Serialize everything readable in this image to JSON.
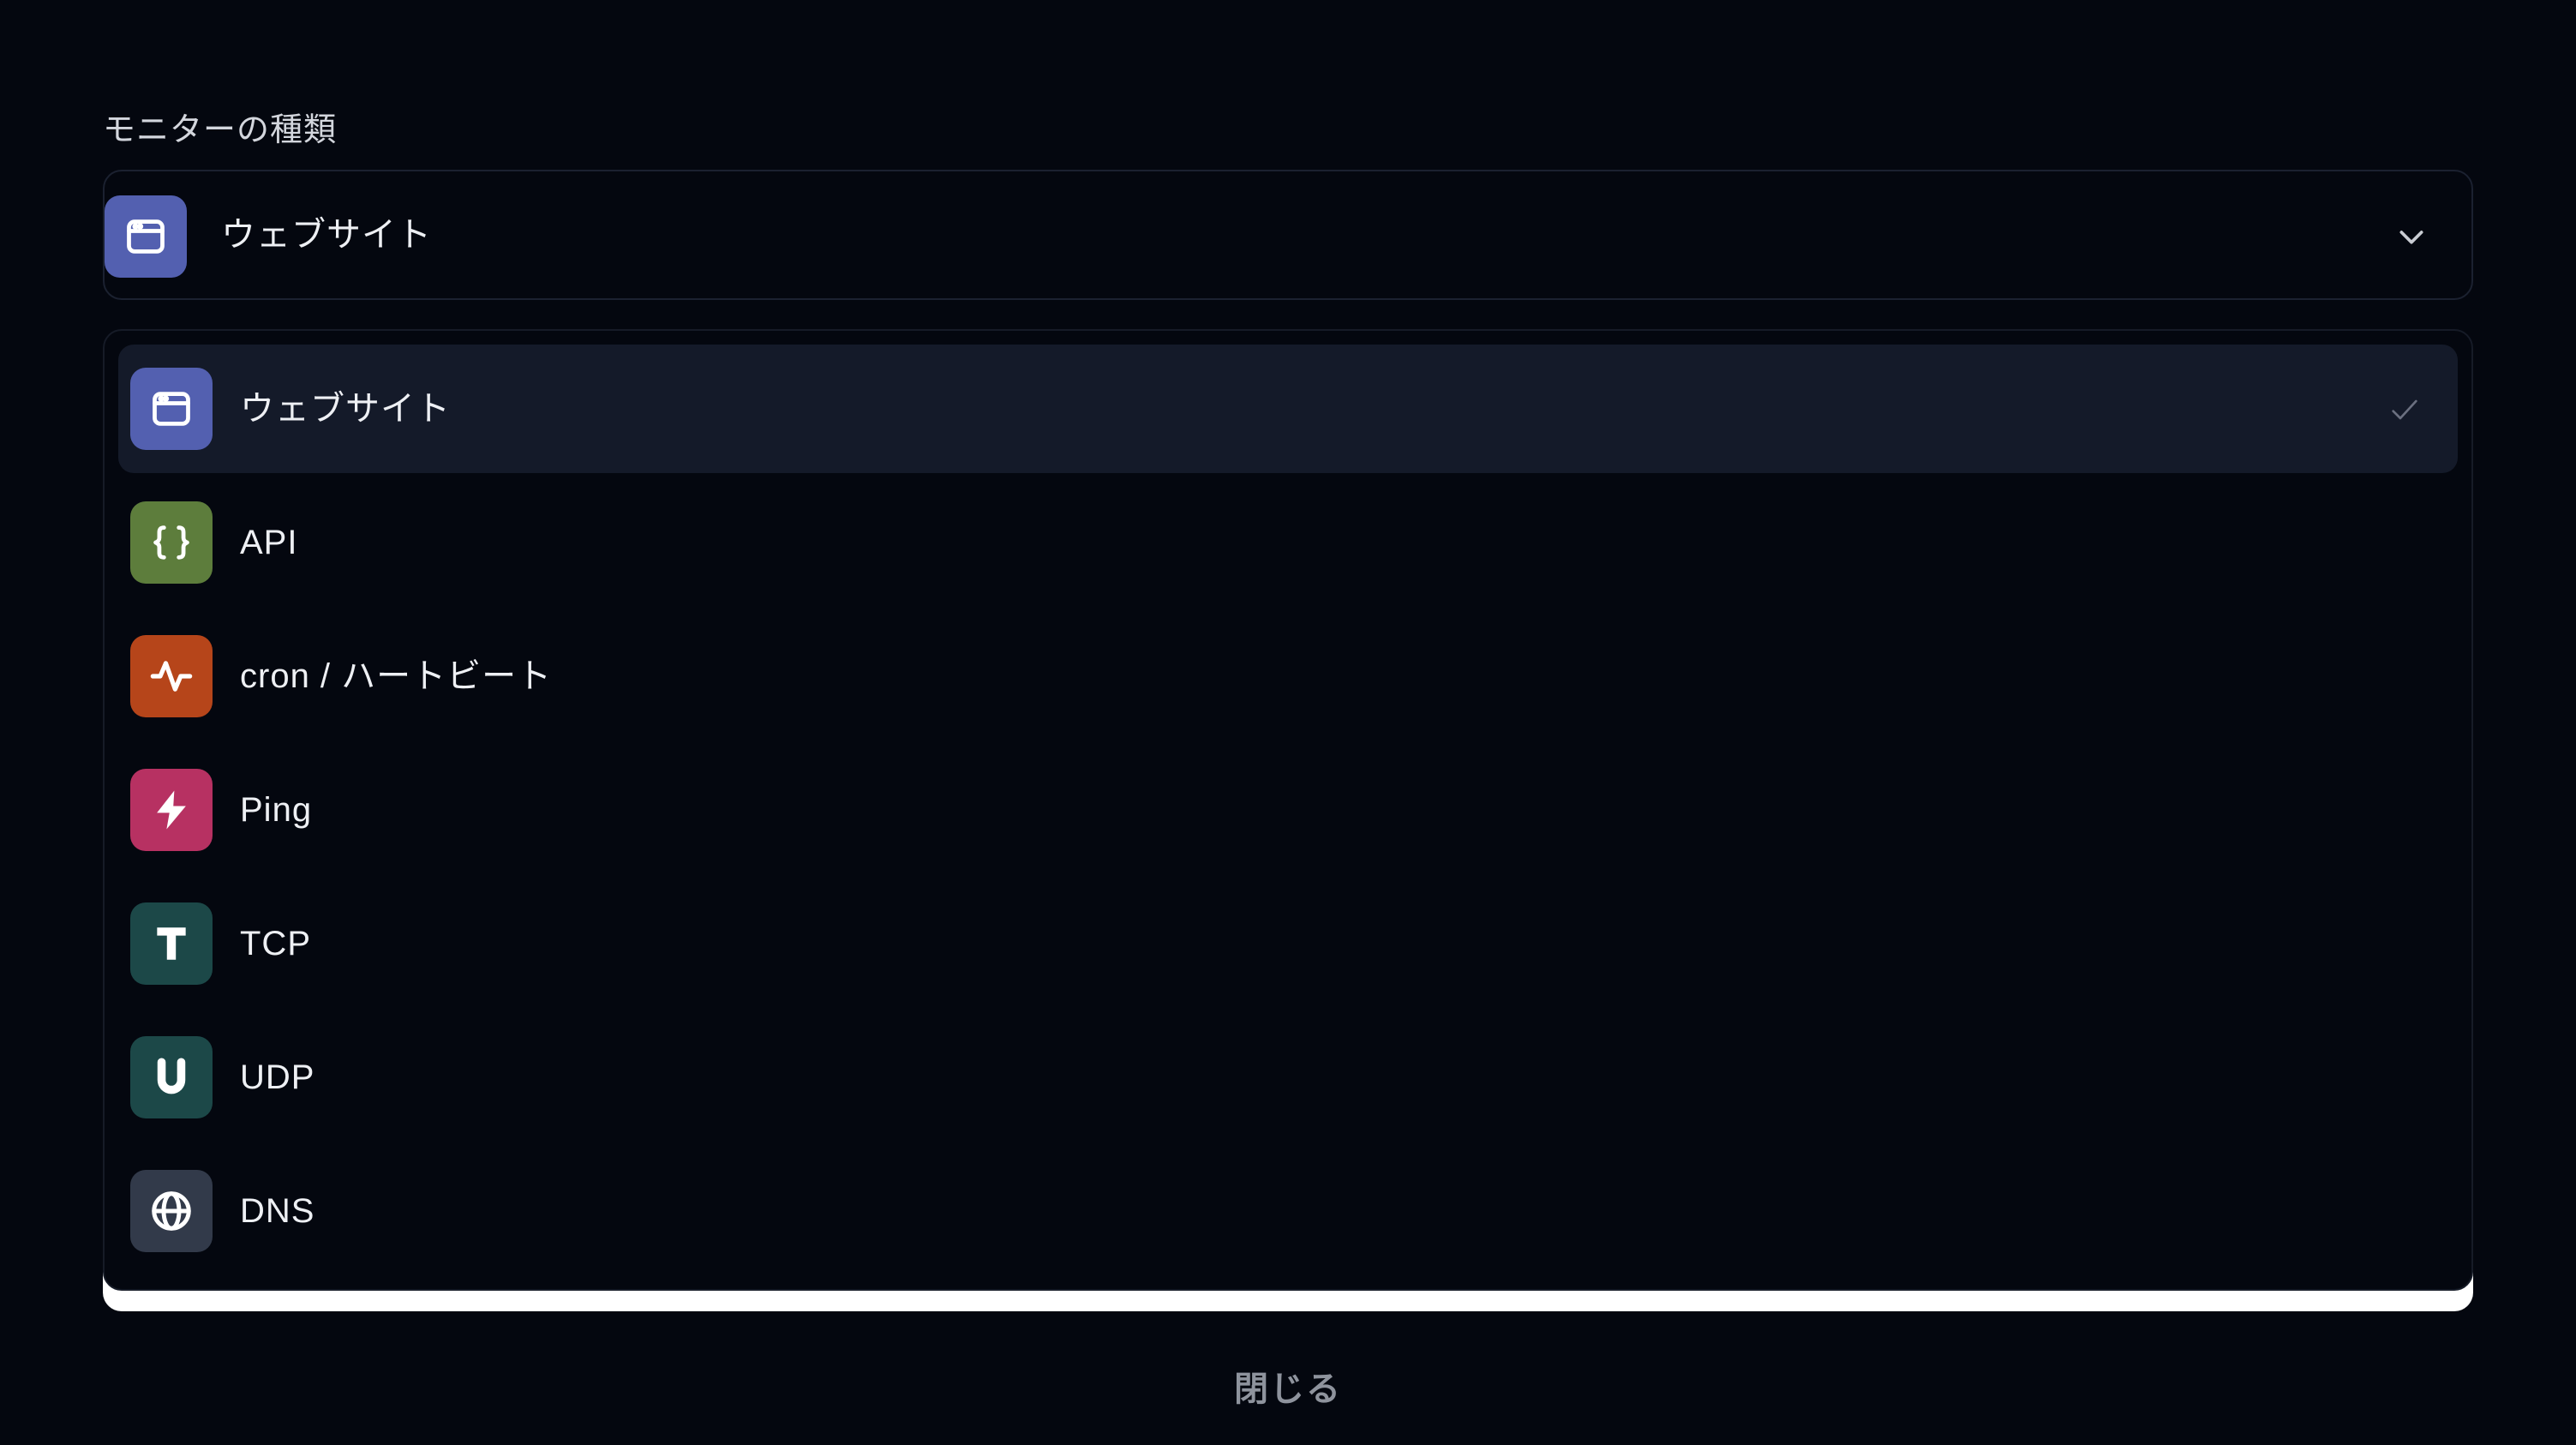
{
  "field": {
    "label": "モニターの種類",
    "selected_value": "ウェブサイト"
  },
  "options": [
    {
      "label": "ウェブサイト",
      "icon": "browser-window-icon",
      "color": "#5360b0",
      "selected": true
    },
    {
      "label": "API",
      "icon": "curly-braces-icon",
      "color": "#5d7d3c",
      "selected": false
    },
    {
      "label": "cron / ハートビート",
      "icon": "pulse-icon",
      "color": "#b6451a",
      "selected": false
    },
    {
      "label": "Ping",
      "icon": "lightning-bolt-icon",
      "color": "#b73162",
      "selected": false
    },
    {
      "label": "TCP",
      "icon": "letter-t-icon",
      "color": "#1c4848",
      "selected": false
    },
    {
      "label": "UDP",
      "icon": "letter-u-icon",
      "color": "#1c4848",
      "selected": false
    },
    {
      "label": "DNS",
      "icon": "globe-icon",
      "color": "#323a4a",
      "selected": false
    }
  ],
  "footer": {
    "close_label": "閉じる"
  }
}
